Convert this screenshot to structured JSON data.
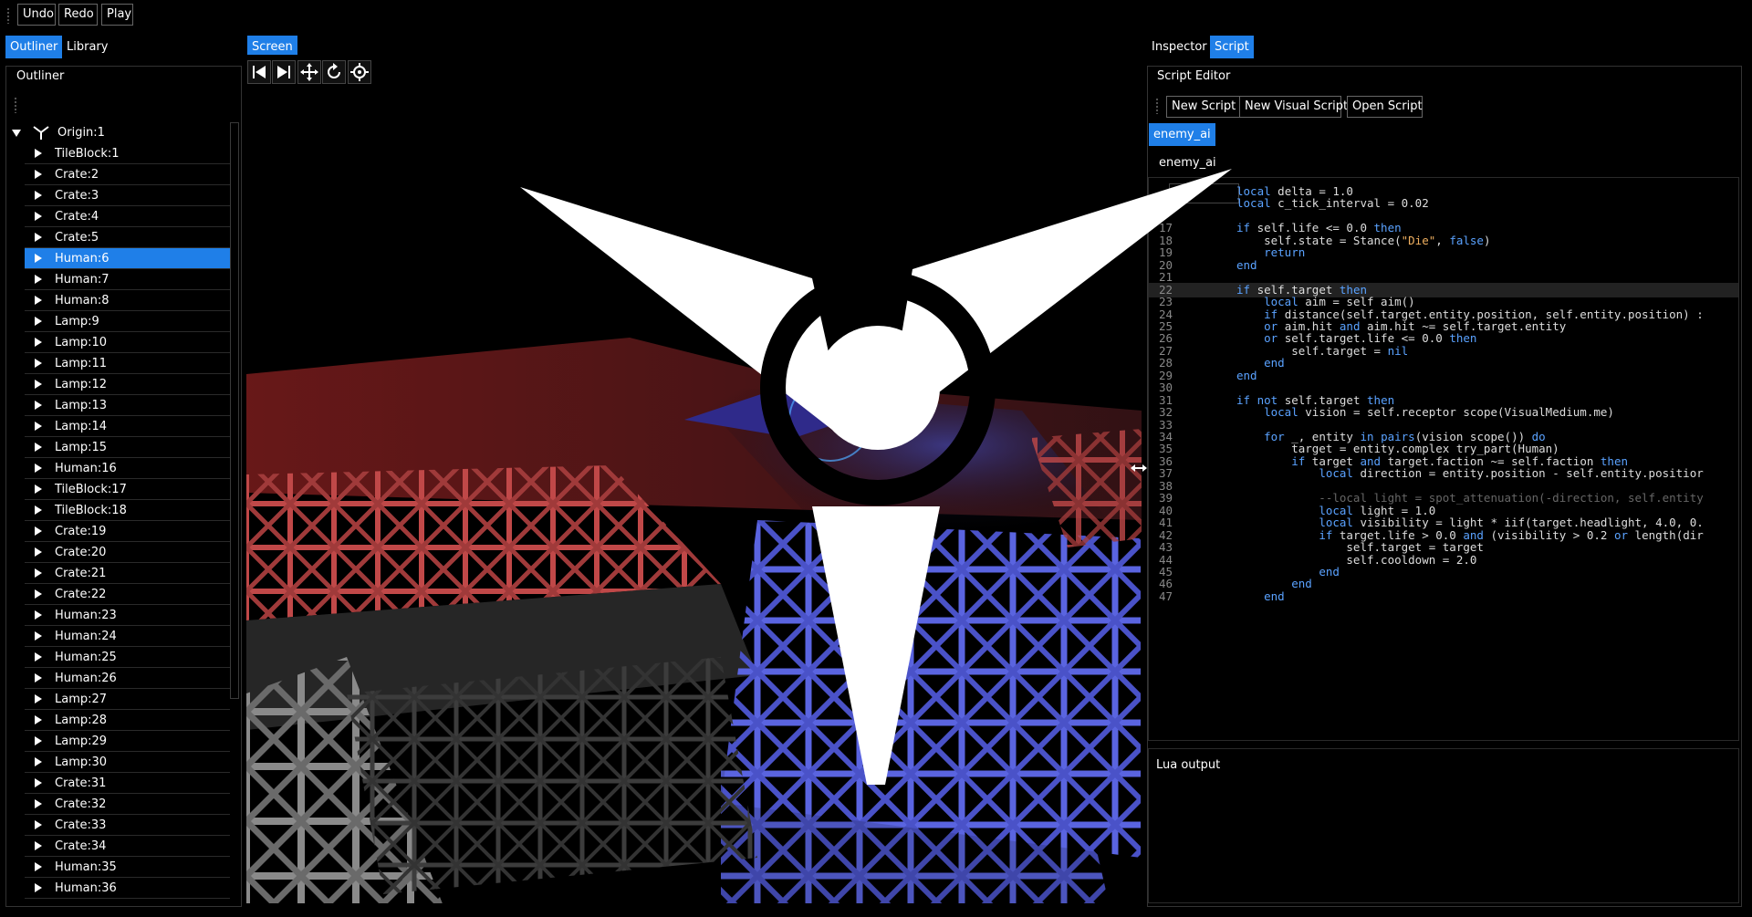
{
  "toolbar": {
    "undo": "Undo",
    "redo": "Redo",
    "play": "Play"
  },
  "left_tabs": [
    "Outliner",
    "Library"
  ],
  "outliner": {
    "title": "Outliner",
    "root": "Origin:1",
    "items": [
      "TileBlock:1",
      "Crate:2",
      "Crate:3",
      "Crate:4",
      "Crate:5",
      "Human:6",
      "Human:7",
      "Human:8",
      "Lamp:9",
      "Lamp:10",
      "Lamp:11",
      "Lamp:12",
      "Lamp:13",
      "Lamp:14",
      "Lamp:15",
      "Human:16",
      "TileBlock:17",
      "TileBlock:18",
      "Crate:19",
      "Crate:20",
      "Crate:21",
      "Crate:22",
      "Human:23",
      "Human:24",
      "Human:25",
      "Human:26",
      "Lamp:27",
      "Lamp:28",
      "Lamp:29",
      "Lamp:30",
      "Crate:31",
      "Crate:32",
      "Crate:33",
      "Crate:34",
      "Human:35",
      "Human:36"
    ],
    "selected": "Human:6"
  },
  "viewport": {
    "tab": "Screen",
    "tools": [
      "skip-start-icon",
      "skip-end-icon",
      "move-icon",
      "rotate-icon",
      "target-icon"
    ]
  },
  "right_tabs": [
    "Inspector",
    "Script"
  ],
  "script_editor": {
    "title": "Script Editor",
    "buttons": {
      "new_script": "New Script",
      "new_visual_script": "New Visual Script",
      "open_script": "Open Script"
    },
    "file_tab": "enemy_ai",
    "file_name": "enemy_ai",
    "lines": [
      {
        "n": "",
        "t": "local delta = 1.0"
      },
      {
        "n": "",
        "t": "local c_tick_interval = 0.02"
      },
      {
        "n": "",
        "t": ""
      },
      {
        "n": "17",
        "t": "if self.life <= 0.0 then"
      },
      {
        "n": "18",
        "t": "    self.state = Stance(\"Die\", false)"
      },
      {
        "n": "19",
        "t": "    return"
      },
      {
        "n": "20",
        "t": "end"
      },
      {
        "n": "21",
        "t": ""
      },
      {
        "n": "22",
        "t": "if self.target then"
      },
      {
        "n": "23",
        "t": "    local aim = self aim()"
      },
      {
        "n": "24",
        "t": "    if distance(self.target.entity.position, self.entity.position) :"
      },
      {
        "n": "25",
        "t": "    or aim.hit and aim.hit ~= self.target.entity"
      },
      {
        "n": "26",
        "t": "    or self.target.life <= 0.0 then"
      },
      {
        "n": "27",
        "t": "        self.target = nil"
      },
      {
        "n": "28",
        "t": "    end"
      },
      {
        "n": "29",
        "t": "end"
      },
      {
        "n": "30",
        "t": ""
      },
      {
        "n": "31",
        "t": "if not self.target then"
      },
      {
        "n": "32",
        "t": "    local vision = self.receptor scope(VisualMedium.me)"
      },
      {
        "n": "33",
        "t": ""
      },
      {
        "n": "34",
        "t": "    for _, entity in pairs(vision scope()) do"
      },
      {
        "n": "35",
        "t": "        target = entity.complex try_part(Human)"
      },
      {
        "n": "36",
        "t": "        if target and target.faction ~= self.faction then"
      },
      {
        "n": "37",
        "t": "            local direction = entity.position - self.entity.positior"
      },
      {
        "n": "38",
        "t": ""
      },
      {
        "n": "39",
        "t": "            --local light = spot_attenuation(-direction, self.entity"
      },
      {
        "n": "40",
        "t": "            local light = 1.0"
      },
      {
        "n": "41",
        "t": "            local visibility = light * iif(target.headlight, 4.0, 0."
      },
      {
        "n": "42",
        "t": "            if target.life > 0.0 and (visibility > 0.2 or length(dir"
      },
      {
        "n": "43",
        "t": "                self.target = target"
      },
      {
        "n": "44",
        "t": "                self.cooldown = 2.0"
      },
      {
        "n": "45",
        "t": "            end"
      },
      {
        "n": "46",
        "t": "        end"
      },
      {
        "n": "47",
        "t": "    end"
      }
    ],
    "highlight_line": "22",
    "output_title": "Lua output"
  }
}
